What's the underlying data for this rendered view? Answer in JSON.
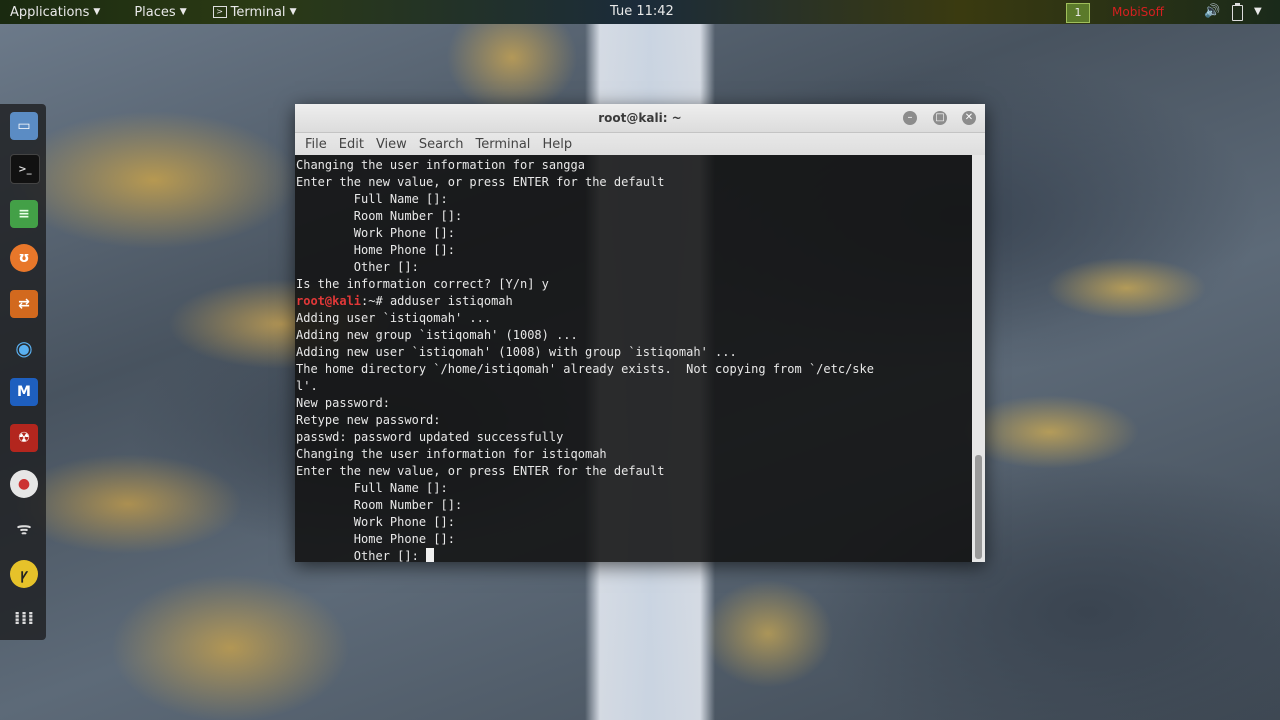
{
  "panel": {
    "applications": "Applications",
    "places": "Places",
    "terminal_app": "Terminal",
    "clock": "Tue 11:42",
    "workspace": "1",
    "user_indicator": "MobiSoff"
  },
  "dock": {
    "items": [
      {
        "name": "files",
        "color": "#4a7fb8"
      },
      {
        "name": "terminal",
        "color": "#1a1a1a"
      },
      {
        "name": "notes",
        "color": "#4caf50"
      },
      {
        "name": "burp",
        "color": "#e8772a"
      },
      {
        "name": "maltego",
        "color": "#e8772a"
      },
      {
        "name": "eye",
        "color": "#3a8fd6"
      },
      {
        "name": "metasploit",
        "color": "#2a62c4"
      },
      {
        "name": "armitage",
        "color": "#c42a2a"
      },
      {
        "name": "recorder",
        "color": "#e0e0e0"
      },
      {
        "name": "wifi",
        "color": "#cfcfcf"
      },
      {
        "name": "wireshark",
        "color": "#e6c22a"
      },
      {
        "name": "apps-grid",
        "color": "#cfcfcf"
      }
    ]
  },
  "window": {
    "title": "root@kali: ~",
    "menu": [
      "File",
      "Edit",
      "View",
      "Search",
      "Terminal",
      "Help"
    ]
  },
  "terminal": {
    "lines": [
      "Changing the user information for sangga",
      "Enter the new value, or press ENTER for the default",
      "        Full Name []:",
      "        Room Number []:",
      "        Work Phone []:",
      "        Home Phone []:",
      "        Other []:",
      "Is the information correct? [Y/n] y"
    ],
    "prompt_user": "root@kali",
    "prompt_path": ":~# ",
    "command": "adduser istiqomah",
    "output": [
      "Adding user `istiqomah' ...",
      "Adding new group `istiqomah' (1008) ...",
      "Adding new user `istiqomah' (1008) with group `istiqomah' ...",
      "The home directory `/home/istiqomah' already exists.  Not copying from `/etc/ske",
      "l'.",
      "New password:",
      "Retype new password:",
      "passwd: password updated successfully",
      "Changing the user information for istiqomah",
      "Enter the new value, or press ENTER for the default",
      "        Full Name []:",
      "        Room Number []:",
      "        Work Phone []:",
      "        Home Phone []:"
    ],
    "last_line": "        Other []: "
  }
}
